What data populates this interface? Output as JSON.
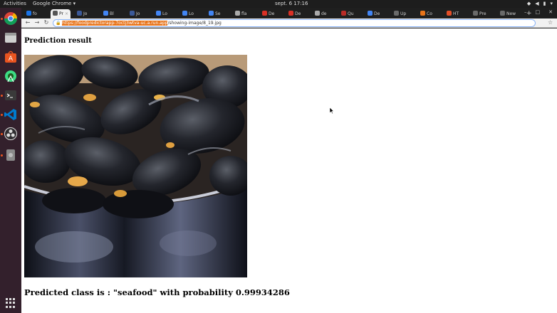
{
  "topbar": {
    "activities": "Activities",
    "app_menu": "Google Chrome ▾",
    "clock": "sept. 6  17:16"
  },
  "tabs": [
    {
      "label": "fo",
      "color": "#1a73e8"
    },
    {
      "label": "Pr",
      "color": "#555555",
      "active": true
    },
    {
      "label": "Jo",
      "color": "#3b5998"
    },
    {
      "label": "Bl",
      "color": "#4285f4"
    },
    {
      "label": "Jo",
      "color": "#3b5998"
    },
    {
      "label": "Lo",
      "color": "#4285f4"
    },
    {
      "label": "Lo",
      "color": "#4285f4"
    },
    {
      "label": "Se",
      "color": "#4285f4"
    },
    {
      "label": "fla",
      "color": "#aaaaaa"
    },
    {
      "label": "De",
      "color": "#d93025"
    },
    {
      "label": "De",
      "color": "#d93025"
    },
    {
      "label": "de",
      "color": "#aaaaaa"
    },
    {
      "label": "Qu",
      "color": "#b92b27"
    },
    {
      "label": "De",
      "color": "#4285f4"
    },
    {
      "label": "Up",
      "color": "#6a6a6a"
    },
    {
      "label": "Co",
      "color": "#e8741a"
    },
    {
      "label": "HT",
      "color": "#e44d26"
    },
    {
      "label": "Pre",
      "color": "#6a6a6a"
    },
    {
      "label": "New",
      "color": "#6a6a6a"
    }
  ],
  "toolbar": {
    "url_highlight": "https://foodpredictorapp-7octj3wtva-uc.a.run.app",
    "url_rest": "/showing-image/8_19.jpg"
  },
  "page": {
    "heading": "Prediction result",
    "result": "Predicted class is : \"seafood\" with probability 0.99934286"
  },
  "icons": {
    "dock": [
      "chrome-icon",
      "files-icon",
      "software-center-icon",
      "android-studio-icon",
      "terminal-icon",
      "vscode-icon",
      "obs-icon",
      "disk-icon"
    ]
  }
}
